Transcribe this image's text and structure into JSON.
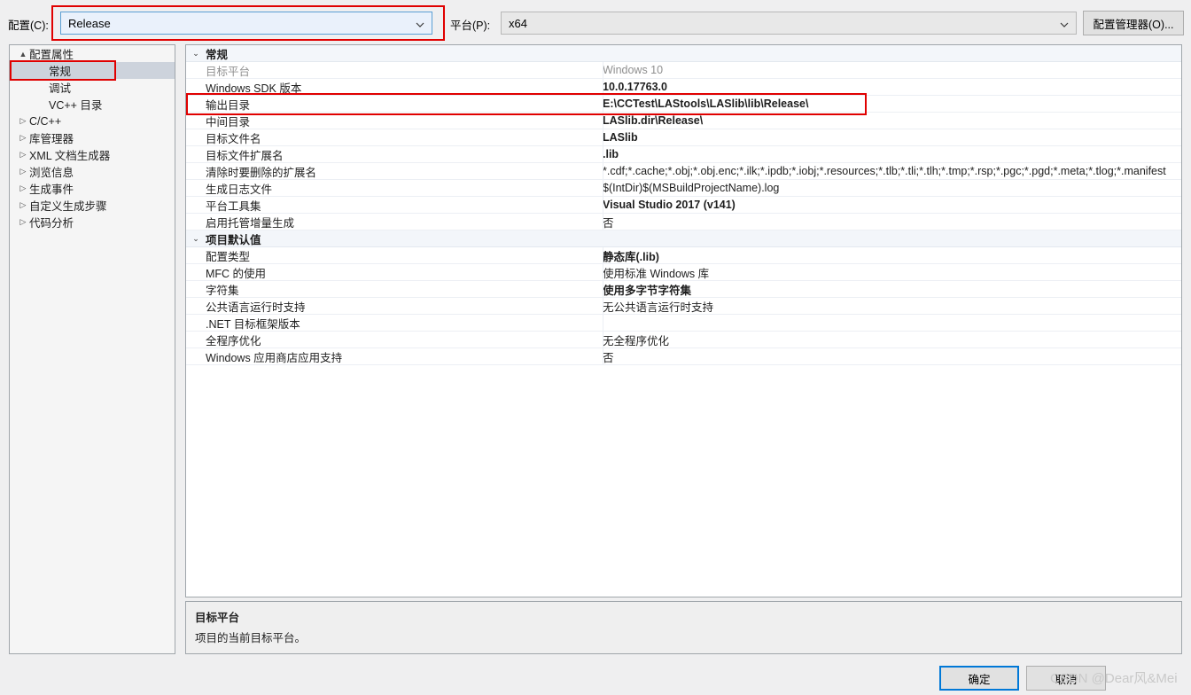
{
  "topbar": {
    "config_label": "配置(C):",
    "config_value": "Release",
    "platform_label": "平台(P):",
    "platform_value": "x64",
    "config_manager_button": "配置管理器(O)..."
  },
  "tree": {
    "items": [
      {
        "label": "配置属性",
        "indent": 0,
        "twisty": "▲",
        "selected": false
      },
      {
        "label": "常规",
        "indent": 1,
        "twisty": "",
        "selected": true
      },
      {
        "label": "调试",
        "indent": 1,
        "twisty": "",
        "selected": false
      },
      {
        "label": "VC++ 目录",
        "indent": 1,
        "twisty": "",
        "selected": false
      },
      {
        "label": "C/C++",
        "indent": 0,
        "twisty": "▷",
        "selected": false
      },
      {
        "label": "库管理器",
        "indent": 0,
        "twisty": "▷",
        "selected": false
      },
      {
        "label": "XML 文档生成器",
        "indent": 0,
        "twisty": "▷",
        "selected": false
      },
      {
        "label": "浏览信息",
        "indent": 0,
        "twisty": "▷",
        "selected": false
      },
      {
        "label": "生成事件",
        "indent": 0,
        "twisty": "▷",
        "selected": false
      },
      {
        "label": "自定义生成步骤",
        "indent": 0,
        "twisty": "▷",
        "selected": false
      },
      {
        "label": "代码分析",
        "indent": 0,
        "twisty": "▷",
        "selected": false
      }
    ]
  },
  "grid": {
    "rows": [
      {
        "kind": "category",
        "name": "常规",
        "value": "",
        "expander": "⌄"
      },
      {
        "kind": "prop",
        "name": "目标平台",
        "value": "Windows 10",
        "name_dim": true,
        "value_dim": true,
        "bold": false
      },
      {
        "kind": "prop",
        "name": "Windows SDK 版本",
        "value": "10.0.17763.0",
        "bold": true
      },
      {
        "kind": "prop",
        "name": "输出目录",
        "value": "E:\\CCTest\\LAStools\\LASlib\\lib\\Release\\",
        "bold": true
      },
      {
        "kind": "prop",
        "name": "中间目录",
        "value": "LASlib.dir\\Release\\",
        "bold": true
      },
      {
        "kind": "prop",
        "name": "目标文件名",
        "value": "LASlib",
        "bold": true
      },
      {
        "kind": "prop",
        "name": "目标文件扩展名",
        "value": ".lib",
        "bold": true
      },
      {
        "kind": "prop",
        "name": "清除时要删除的扩展名",
        "value": "*.cdf;*.cache;*.obj;*.obj.enc;*.ilk;*.ipdb;*.iobj;*.resources;*.tlb;*.tli;*.tlh;*.tmp;*.rsp;*.pgc;*.pgd;*.meta;*.tlog;*.manifest",
        "bold": false
      },
      {
        "kind": "prop",
        "name": "生成日志文件",
        "value": "$(IntDir)$(MSBuildProjectName).log",
        "bold": false
      },
      {
        "kind": "prop",
        "name": "平台工具集",
        "value": "Visual Studio 2017 (v141)",
        "bold": true
      },
      {
        "kind": "prop",
        "name": "启用托管增量生成",
        "value": "否",
        "bold": false
      },
      {
        "kind": "category",
        "name": "项目默认值",
        "value": "",
        "expander": "⌄"
      },
      {
        "kind": "prop",
        "name": "配置类型",
        "value": "静态库(.lib)",
        "bold": true
      },
      {
        "kind": "prop",
        "name": "MFC 的使用",
        "value": "使用标准 Windows 库",
        "bold": false
      },
      {
        "kind": "prop",
        "name": "字符集",
        "value": "使用多字节字符集",
        "bold": true
      },
      {
        "kind": "prop",
        "name": "公共语言运行时支持",
        "value": "无公共语言运行时支持",
        "bold": false
      },
      {
        "kind": "prop",
        "name": ".NET 目标框架版本",
        "value": "",
        "bold": false
      },
      {
        "kind": "prop",
        "name": "全程序优化",
        "value": "无全程序优化",
        "bold": false
      },
      {
        "kind": "prop",
        "name": "Windows 应用商店应用支持",
        "value": "否",
        "bold": false
      }
    ]
  },
  "description": {
    "title": "目标平台",
    "body": "项目的当前目标平台。"
  },
  "footer": {
    "ok_label": "确定",
    "cancel_label": "取消",
    "watermark": "CSDN @Dear风&Mei"
  },
  "colors": {
    "accent": "#0078d7",
    "highlight_box": "#e00000",
    "selection": "#cdd3dc",
    "category_bg": "#f3f6fa"
  }
}
